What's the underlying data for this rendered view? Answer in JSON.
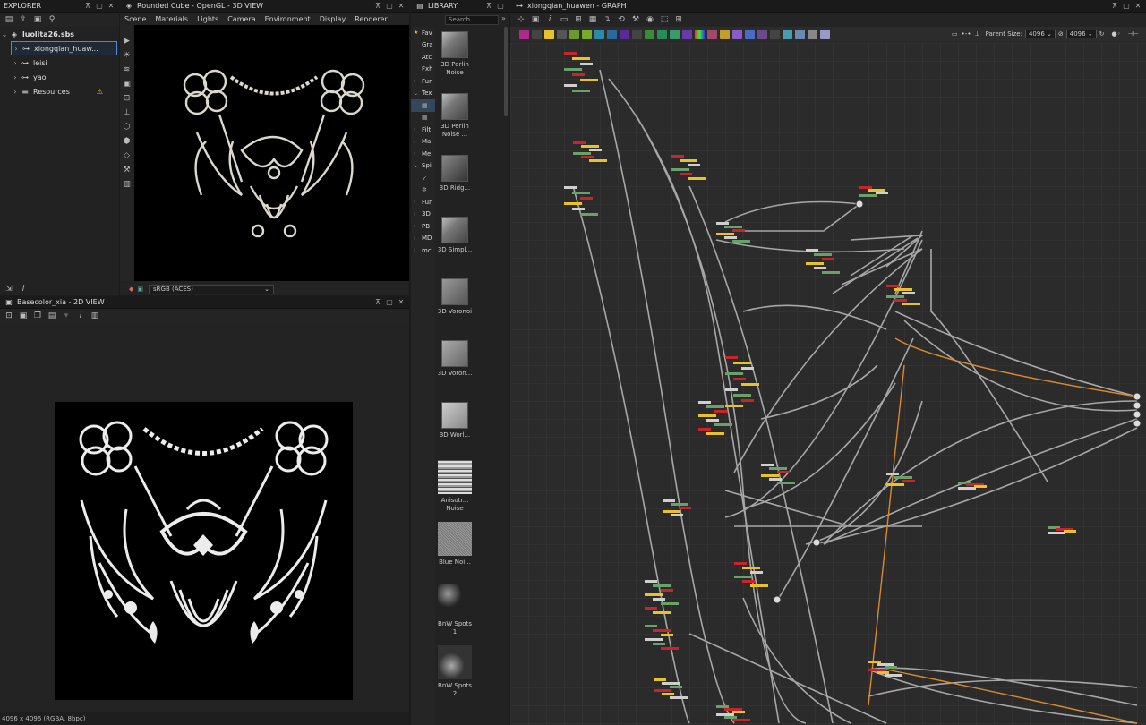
{
  "explorer": {
    "title": "EXPLORER",
    "package": "luolita26.sbs",
    "items": [
      {
        "label": "xiongqian_huaw...",
        "icon": "graph-icon",
        "selected": true
      },
      {
        "label": "leisi",
        "icon": "graph-icon",
        "selected": false
      },
      {
        "label": "yao",
        "icon": "graph-icon",
        "selected": false
      },
      {
        "label": "Resources",
        "icon": "folder-icon",
        "selected": false
      }
    ],
    "warning_icon": "warning-icon"
  },
  "view3d": {
    "title": "Rounded Cube - OpenGL - 3D VIEW",
    "menu": [
      "Scene",
      "Materials",
      "Lights",
      "Camera",
      "Environment",
      "Display",
      "Renderer"
    ],
    "colorspace": "sRGB (ACES)"
  },
  "view2d": {
    "title": "Basecolor_xia - 2D VIEW",
    "status": "4096 x 4096 (RGBA, 8bpc)"
  },
  "library": {
    "title": "LIBRARY",
    "search_placeholder": "Search",
    "categories": [
      "Fav",
      "Gra",
      "Atc",
      "Fxh",
      "Fun",
      "Tex",
      "",
      "",
      "Filt",
      "Ma",
      "Me",
      "Spi",
      "",
      "",
      "Fun",
      "3D",
      "PB",
      "MD",
      "mc"
    ],
    "items": [
      {
        "label": "3D Perlin Noise",
        "thumb": "cube"
      },
      {
        "label": "3D Perlin Noise ...",
        "thumb": "cube"
      },
      {
        "label": "3D Ridg...",
        "thumb": "cube"
      },
      {
        "label": "3D Simpl...",
        "thumb": "cube"
      },
      {
        "label": "3D Voronoi",
        "thumb": "cube"
      },
      {
        "label": "3D Voron...",
        "thumb": "cube"
      },
      {
        "label": "3D Worl...",
        "thumb": "cube"
      },
      {
        "label": "Anisotr... Noise",
        "thumb": "stripes"
      },
      {
        "label": "Blue Noi...",
        "thumb": "noise"
      },
      {
        "label": "BnW Spots 1",
        "thumb": "spots"
      },
      {
        "label": "BnW Spots 2",
        "thumb": "spots"
      }
    ]
  },
  "graph": {
    "title": "xiongqian_huawen - GRAPH",
    "parent_size_label": "Parent Size:",
    "parent_size_value": "4096",
    "size_value": "4096"
  },
  "colors": {
    "panel_bg": "#222222",
    "graph_bg": "#2b2b2b",
    "accent": "#4a88d1",
    "node_red": "#c8242a",
    "node_yellow": "#e8c22a",
    "link_orange": "#d98a2b"
  }
}
